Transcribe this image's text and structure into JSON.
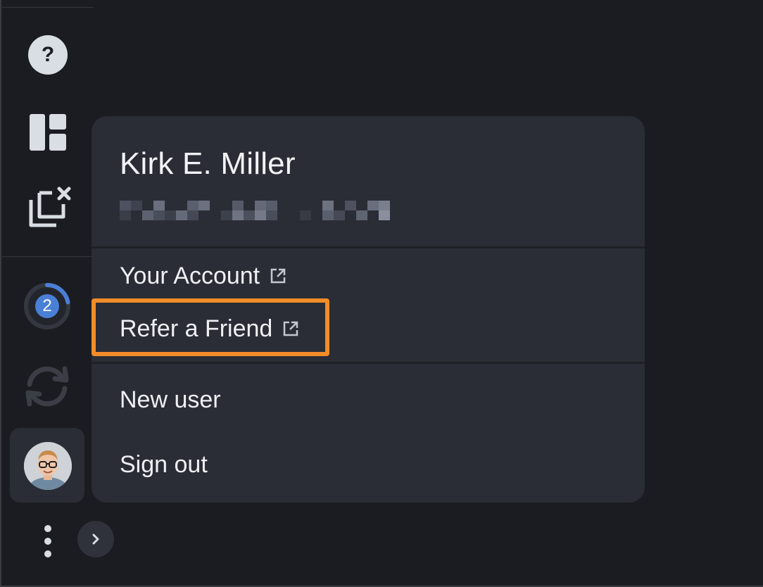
{
  "sidebar": {
    "help_label": "?",
    "icons": {
      "help": "help-circle-icon",
      "dashboard": "dashboard-layout-icon",
      "clear": "clear-clipboard-icon",
      "sync": "sync-icon",
      "more": "more-vertical-icon",
      "expand": "chevron-right-icon"
    },
    "task_count": "2",
    "task_progress": 0.22
  },
  "user_menu": {
    "name": "Kirk E. Miller",
    "email_redacted": true,
    "items": [
      {
        "label": "Your Account",
        "external": true
      },
      {
        "label": "Refer a Friend",
        "external": true,
        "highlighted": true
      },
      {
        "label": "New user",
        "external": false
      },
      {
        "label": "Sign out",
        "external": false
      }
    ]
  },
  "colors": {
    "background": "#1b1c21",
    "menu": "#2a2d35",
    "accent": "#4a7fd6",
    "highlight": "#f28c28"
  }
}
